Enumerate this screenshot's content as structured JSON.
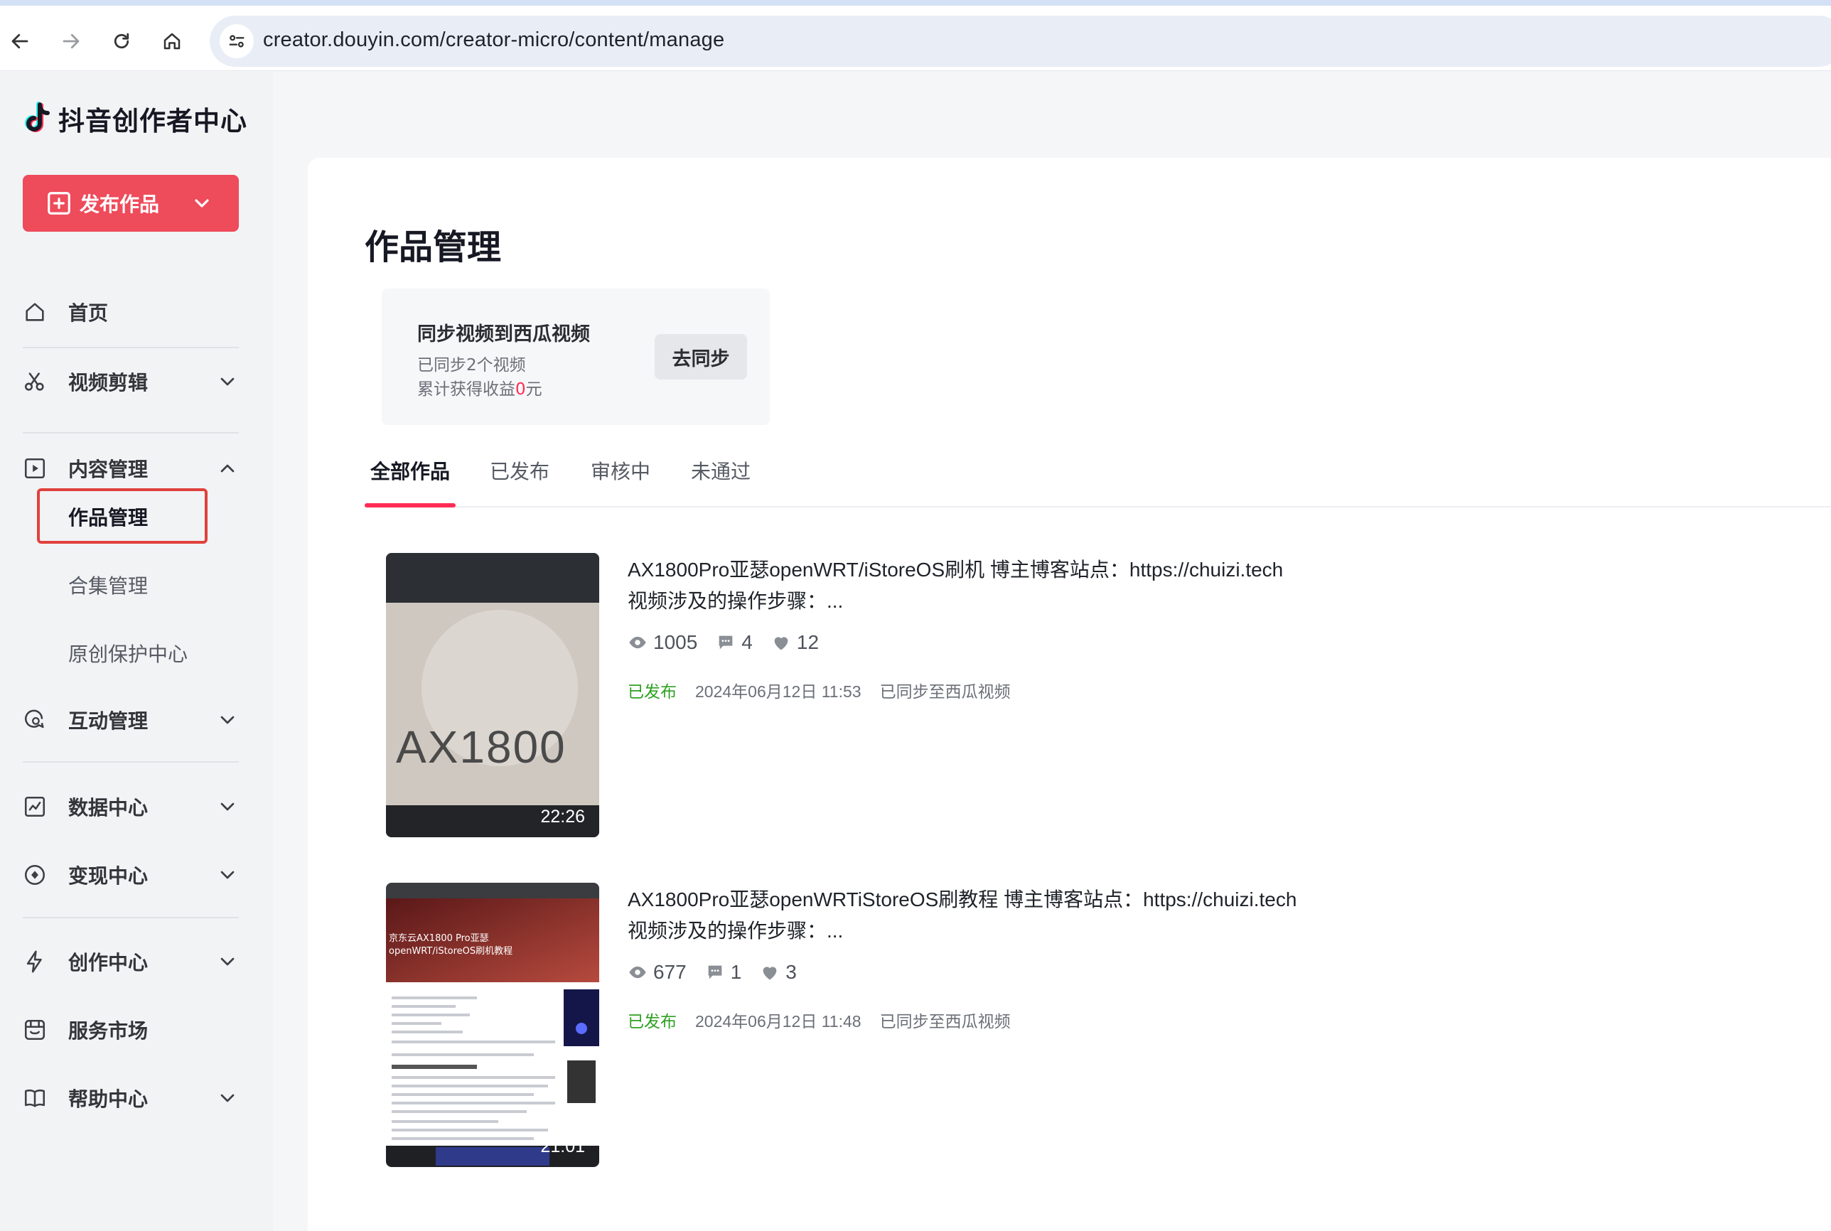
{
  "browser": {
    "url": "creator.douyin.com/creator-micro/content/manage",
    "icons": [
      "back-icon",
      "forward-icon",
      "reload-icon",
      "home-icon",
      "site-settings-icon"
    ]
  },
  "sidebar": {
    "app_name": "抖音创作者中心",
    "publish_label": "发布作品",
    "items": [
      {
        "label": "首页",
        "icon": "home-icon"
      },
      {
        "label": "视频剪辑",
        "icon": "scissors-icon"
      },
      {
        "label": "内容管理",
        "icon": "play-square-icon"
      },
      {
        "label": "互动管理",
        "icon": "chat-search-icon"
      },
      {
        "label": "数据中心",
        "icon": "chart-icon"
      },
      {
        "label": "变现中心",
        "icon": "coin-icon"
      },
      {
        "label": "创作中心",
        "icon": "lightning-icon"
      },
      {
        "label": "服务市场",
        "icon": "shop-icon"
      },
      {
        "label": "帮助中心",
        "icon": "book-icon"
      }
    ],
    "content_sub": [
      "作品管理",
      "合集管理",
      "原创保护中心"
    ]
  },
  "main": {
    "title": "作品管理",
    "sync": {
      "title": "同步视频到西瓜视频",
      "line1": "已同步2个视频",
      "line2_prefix": "累计获得收益",
      "line2_value": "0",
      "line2_suffix": "元",
      "button": "去同步"
    },
    "tabs": [
      "全部作品",
      "已发布",
      "审核中",
      "未通过"
    ],
    "works": [
      {
        "title_line1": "AX1800Pro亚瑟openWRT/iStoreOS刷机 博主博客站点：https://chuizi.tech",
        "title_line2": "视频涉及的操作步骤：...",
        "views": "1005",
        "comments": "4",
        "likes": "12",
        "status": "已发布",
        "date": "2024年06月12日 11:53",
        "sync_status": "已同步至西瓜视频",
        "duration": "22:26",
        "thumb_text": "AX1800"
      },
      {
        "title_line1": "AX1800Pro亚瑟openWRTiStoreOS刷教程 博主博客站点：https://chuizi.tech",
        "title_line2": "视频涉及的操作步骤：...",
        "views": "677",
        "comments": "1",
        "likes": "3",
        "status": "已发布",
        "date": "2024年06月12日 11:48",
        "sync_status": "已同步至西瓜视频",
        "duration": "21:01",
        "thumb_text": "京东云AX1800 Pro亚瑟openWRT/iStoreOS刷机教程"
      }
    ]
  },
  "colors": {
    "brand_red": "#ee4b5b",
    "accent_pink": "#fe2c55",
    "published_green": "#2ea121",
    "highlight_border": "#e0413d"
  }
}
